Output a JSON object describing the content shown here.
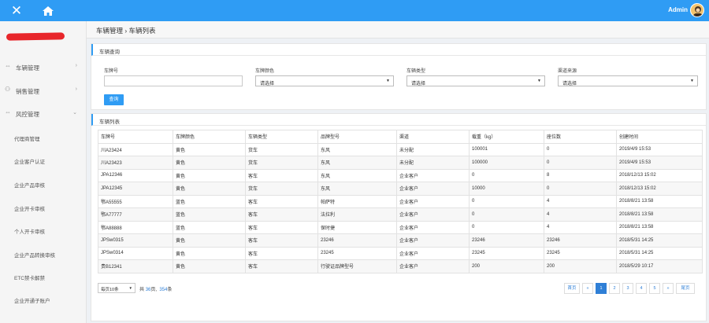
{
  "topbar": {
    "close_icon": "✕",
    "user_name": "Admin"
  },
  "sidebar": {
    "menus": [
      {
        "icon": "car-icon",
        "glyph": "⇔",
        "label": "车辆管理",
        "chevron": "›"
      },
      {
        "icon": "sales-icon",
        "glyph": "⚇",
        "label": "销售管理",
        "chevron": "›"
      },
      {
        "icon": "shield-icon",
        "glyph": "⇔",
        "label": "风控管理",
        "chevron": "⌄"
      }
    ],
    "sub_items": [
      "代理商管理",
      "企业客户认证",
      "企业产品审核",
      "企业开卡审核",
      "个人开卡审核",
      "企业产品转换审核",
      "ETC禁卡解禁",
      "企业开通子账户"
    ]
  },
  "breadcrumb": {
    "text": "车辆管理 › 车辆列表"
  },
  "query_panel": {
    "title": "车辆查询",
    "fields": [
      {
        "label": "车牌号",
        "value": ""
      },
      {
        "label": "车牌颜色",
        "value": "请选择"
      },
      {
        "label": "车辆类型",
        "value": "请选择"
      },
      {
        "label": "渠道来源",
        "value": "请选择"
      }
    ],
    "query_button": "查询"
  },
  "list_panel": {
    "title": "车辆列表",
    "columns": [
      "车牌号",
      "车牌颜色",
      "车辆类型",
      "品牌型号",
      "渠道",
      "载重（kg）",
      "座位数",
      "创建时间"
    ],
    "rows": [
      [
        "川A23424",
        "黄色",
        "货车",
        "东风",
        "未分配",
        "100001",
        "0",
        "2019/4/9 15:53"
      ],
      [
        "川A23423",
        "黄色",
        "货车",
        "东风",
        "未分配",
        "100000",
        "0",
        "2019/4/9 15:53"
      ],
      [
        "JPA12346",
        "黄色",
        "客车",
        "东风",
        "企业客户",
        "0",
        "8",
        "2018/12/13 15:02"
      ],
      [
        "JPA12345",
        "黄色",
        "货车",
        "东风",
        "企业客户",
        "10000",
        "0",
        "2018/12/13 15:02"
      ],
      [
        "鄂A55555",
        "蓝色",
        "客车",
        "帕萨特",
        "企业客户",
        "0",
        "4",
        "2018/8/21 13:58"
      ],
      [
        "鄂A77777",
        "蓝色",
        "客车",
        "法拉利",
        "企业客户",
        "0",
        "4",
        "2018/8/21 13:58"
      ],
      [
        "鄂A88888",
        "蓝色",
        "客车",
        "保时捷",
        "企业客户",
        "0",
        "4",
        "2018/8/21 13:58"
      ],
      [
        "JPSw0315",
        "黄色",
        "客车",
        "23246",
        "企业客户",
        "23246",
        "23246",
        "2018/5/31 14:25"
      ],
      [
        "JPSw0314",
        "黄色",
        "客车",
        "23245",
        "企业客户",
        "23245",
        "23245",
        "2018/5/31 14:25"
      ],
      [
        "贵B12341",
        "黄色",
        "客车",
        "行驶证品牌型号",
        "企业客户",
        "200",
        "200",
        "2018/5/29 10:17"
      ]
    ]
  },
  "pager": {
    "page_size": "每页10条",
    "total_prefix": "共",
    "total_pages": "36",
    "pages_suffix": "页,",
    "total_records": "354",
    "records_suffix": "条",
    "buttons": [
      "首页",
      "«",
      "1",
      "2",
      "3",
      "4",
      "5",
      "»",
      "尾页"
    ],
    "active": "1"
  },
  "colors": {
    "accent": "#2f9cf4",
    "link": "#2f7fd6"
  }
}
